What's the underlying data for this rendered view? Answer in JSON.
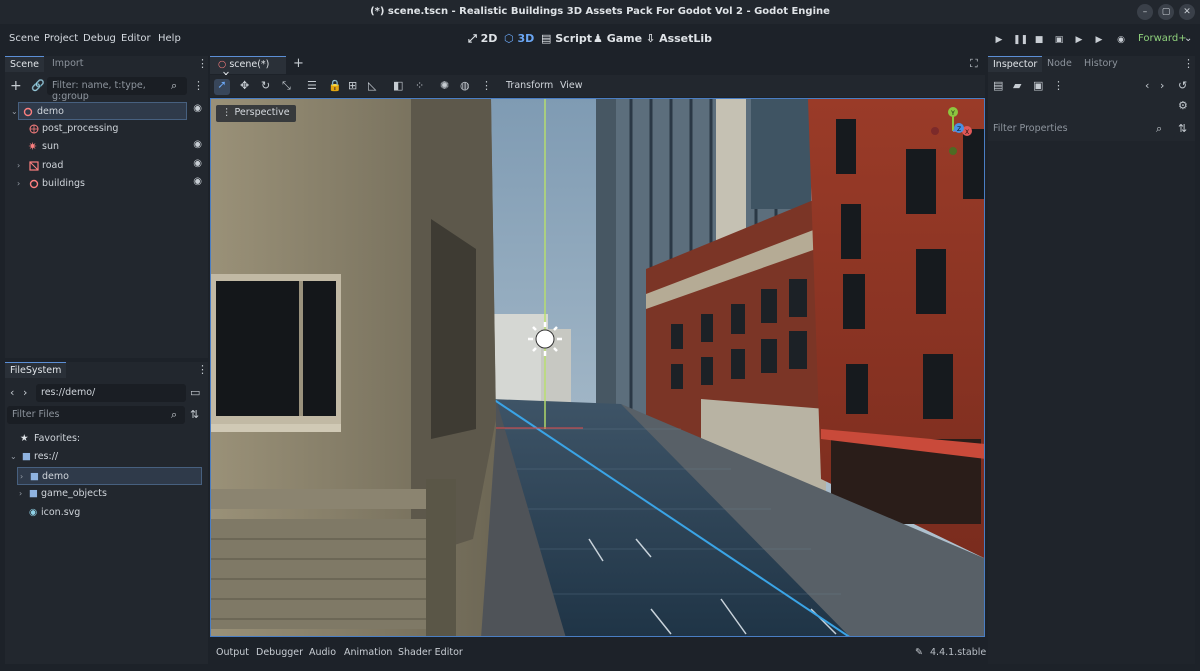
{
  "window": {
    "title": "(*) scene.tscn - Realistic Buildings 3D Assets Pack For Godot Vol 2 - Godot Engine",
    "controls": [
      "–",
      "▢",
      "✕"
    ]
  },
  "menu": [
    "Scene",
    "Project",
    "Debug",
    "Editor",
    "Help"
  ],
  "workspaces": [
    {
      "label": "2D",
      "icon": "2d-icon"
    },
    {
      "label": "3D",
      "icon": "3d-icon"
    },
    {
      "label": "Script",
      "icon": "script-icon"
    },
    {
      "label": "Game",
      "icon": "game-icon"
    },
    {
      "label": "AssetLib",
      "icon": "assetlib-icon"
    }
  ],
  "renderer": "Forward+",
  "scene_dock": {
    "tabs": [
      "Scene",
      "Import"
    ],
    "filter_placeholder": "Filter: name, t:type, g:group",
    "nodes": [
      {
        "name": "demo",
        "icon": "node3d-icon",
        "expanded": true,
        "visible_toggle": true
      },
      {
        "name": "post_processing",
        "icon": "world-environment-icon",
        "visible_toggle": false
      },
      {
        "name": "sun",
        "icon": "directional-light-icon",
        "visible_toggle": true
      },
      {
        "name": "road",
        "icon": "mesh-instance-icon",
        "visible_toggle": true
      },
      {
        "name": "buildings",
        "icon": "node3d-icon",
        "visible_toggle": true
      }
    ]
  },
  "filesystem_dock": {
    "tab": "FileSystem",
    "path": "res://demo/",
    "filter_placeholder": "Filter Files",
    "items": [
      {
        "name": "Favorites:",
        "icon": "star-icon"
      },
      {
        "name": "res://",
        "icon": "folder-icon"
      },
      {
        "name": "demo",
        "icon": "folder-icon"
      },
      {
        "name": "game_objects",
        "icon": "folder-icon"
      },
      {
        "name": "icon.svg",
        "icon": "svg-file-icon"
      }
    ]
  },
  "editor_tabs": [
    {
      "label": "scene(*)"
    }
  ],
  "viewport_toolbar": {
    "transform_menu": "Transform",
    "view_menu": "View",
    "perspective_label": "Perspective"
  },
  "gizmo": {
    "x": "X",
    "y": "Y",
    "z": "Z"
  },
  "inspector": {
    "tabs": [
      "Inspector",
      "Node",
      "History"
    ],
    "filter_placeholder": "Filter Properties"
  },
  "bottom_panel": {
    "tabs": [
      "Output",
      "Debugger",
      "Audio",
      "Animation",
      "Shader Editor"
    ],
    "version": "4.4.1.stable"
  },
  "colors": {
    "accent": "#6ba7f5",
    "selection": "#2f3a4a",
    "brick": "#a33a2a",
    "sky": "#a9c0d3"
  }
}
